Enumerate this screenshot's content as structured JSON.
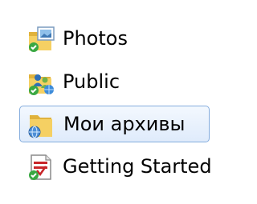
{
  "navigation": {
    "items": [
      {
        "label": "Photos",
        "icon": "library-photos-icon",
        "selected": false
      },
      {
        "label": "Public",
        "icon": "shared-public-folder-icon",
        "selected": false
      },
      {
        "label": "Мои архивы",
        "icon": "folder-network-icon",
        "selected": true
      },
      {
        "label": "Getting Started",
        "icon": "getting-started-document-icon",
        "selected": false
      }
    ]
  },
  "colors": {
    "selection_border": "#84acdd",
    "selection_fill_top": "#f3f8fe",
    "selection_fill_bottom": "#dfebfb",
    "folder_yellow": "#f5d063",
    "badge_green": "#3aa843",
    "document_red": "#c8262a"
  }
}
